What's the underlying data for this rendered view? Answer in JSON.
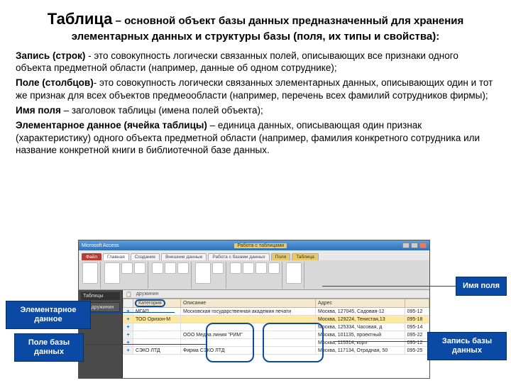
{
  "heading": {
    "word": "Таблица",
    "rest1": " – основной объект базы данных предназначенный для хранения",
    "rest2": "элементарных данных и структуры базы (поля, их типы и свойства):"
  },
  "paras": [
    {
      "lead": "Запись (строк)",
      "body": " - это совокупность логически связанных полей, описывающих все признаки одного объекта предметной области (например, данные об одном сотруднике);"
    },
    {
      "lead": "Поле (столбцов)",
      "body": "- это совокупность логически связанных элементарных данных, описывающих один и тот же признак для всех объектов предмеообласти (например, перечень всех фамилий сотрудников фирмы);"
    },
    {
      "lead": "Имя поля",
      "body": " – заголовок таблицы (имена полей объекта);"
    },
    {
      "lead": "Элементарное данное (ячейка таблицы)",
      "body": " – единица данных, описывающая один признак (характеристику) одного объекта предметной области (например, фамилия конкретного сотрудника или название конкретной книги в библиотечной базе данных."
    }
  ],
  "annotations": {
    "field_name": "Имя поля",
    "elementary": "Элементарное данное",
    "db_field": "Поле базы данных",
    "db_record": "Запись базы данных"
  },
  "access": {
    "title": "Microsoft Access",
    "context_title": "Работа с таблицами",
    "tabs": {
      "file": "Файл",
      "home": "Главная",
      "create": "Создание",
      "external": "Внешние данные",
      "dbtools": "Работа с базами данных",
      "fields": "Поля",
      "table": "Таблица"
    },
    "nav": {
      "header": "Таблицы",
      "item": "дружинин"
    },
    "subtab": "дружинин",
    "columns": [
      "",
      "Категория",
      "Описание",
      "Адрес",
      ""
    ],
    "rows": [
      [
        "+",
        "МГАП",
        "Московская государственная академия печати",
        "Москва, 127045, Садовая-12",
        "095-12"
      ],
      [
        "+",
        "ТОО Оризон-М",
        "",
        "Москва, 129224, Тенистая,13",
        "095-18"
      ],
      [
        "+",
        "",
        "",
        "Москва, 125334, Часовая, д",
        "095-14"
      ],
      [
        "+",
        "",
        "ООО Медиа линия \"РИМ\"",
        "Москва, 101135, проектный",
        "095-22"
      ],
      [
        "+",
        "",
        "",
        "Москва, 115314, корп",
        "095-12"
      ],
      [
        "+",
        "СЭКО ЛТД",
        "Фирма СЭКО ЛТД",
        "Москва, 117134, Отрадная, 50",
        "095-25"
      ]
    ]
  }
}
